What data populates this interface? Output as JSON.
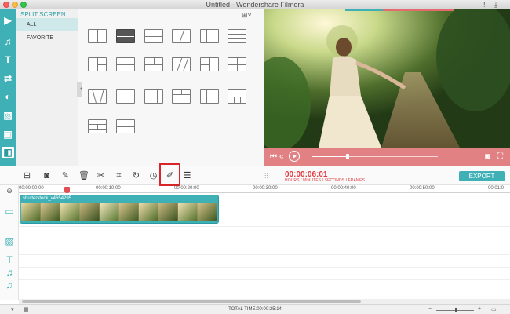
{
  "window": {
    "title": "Untitled - Wondershare Filmora"
  },
  "rail": {
    "items": [
      {
        "icon": "media-icon",
        "glyph": "▶"
      },
      {
        "icon": "music-icon",
        "glyph": "♫"
      },
      {
        "icon": "text-icon",
        "glyph": "T"
      },
      {
        "icon": "transition-icon",
        "glyph": "⇄"
      },
      {
        "icon": "filter-icon",
        "glyph": "◐"
      },
      {
        "icon": "overlay-icon",
        "glyph": "▧"
      },
      {
        "icon": "elements-icon",
        "glyph": "▣"
      },
      {
        "icon": "split-screen-icon",
        "glyph": "◧"
      }
    ]
  },
  "categories": {
    "header": "SPLIT SCREEN",
    "items": [
      "ALL",
      "FAVORITE"
    ]
  },
  "toolbar": {
    "timecode": "00:00:06:01",
    "timecode_label": "HOURS / MINUTES / SECONDS / FRAMES",
    "export_label": "EXPORT",
    "tools": [
      {
        "name": "add-media-icon",
        "glyph": "⊞"
      },
      {
        "name": "record-icon",
        "glyph": "◙"
      },
      {
        "name": "edit-pen-icon",
        "glyph": "✎"
      },
      {
        "name": "delete-icon",
        "glyph": "🗑"
      },
      {
        "name": "cut-icon",
        "glyph": "✂"
      },
      {
        "name": "crop-icon",
        "glyph": "⌗"
      },
      {
        "name": "rotate-icon",
        "glyph": "↻"
      },
      {
        "name": "speed-icon",
        "glyph": "◷"
      },
      {
        "name": "power-tool-icon",
        "glyph": "✐"
      },
      {
        "name": "settings-sliders-icon",
        "glyph": "☰"
      }
    ]
  },
  "timeline": {
    "ruler": [
      "00:00:00:00",
      "00:00:10:00",
      "00:00:20:00",
      "00:00:30:00",
      "00:00:40:00",
      "00:00:50:00",
      "00:01:0"
    ],
    "clip_name": "shutterstock_v4654295",
    "track_icons": [
      {
        "name": "video-track-icon",
        "glyph": "▭"
      },
      {
        "name": "image-track-icon",
        "glyph": "▨"
      },
      {
        "name": "text-track-icon",
        "glyph": "T"
      },
      {
        "name": "music-track-icon",
        "glyph": "♫"
      },
      {
        "name": "audio-track-icon",
        "glyph": "♫"
      }
    ]
  },
  "status": {
    "total_time": "TOTAL TIME:00:00:25:14"
  },
  "colors": {
    "accent": "#3fb1b6",
    "preview_bar": "#e28183",
    "timecode": "#e0393e",
    "highlight": "#d9252a"
  }
}
